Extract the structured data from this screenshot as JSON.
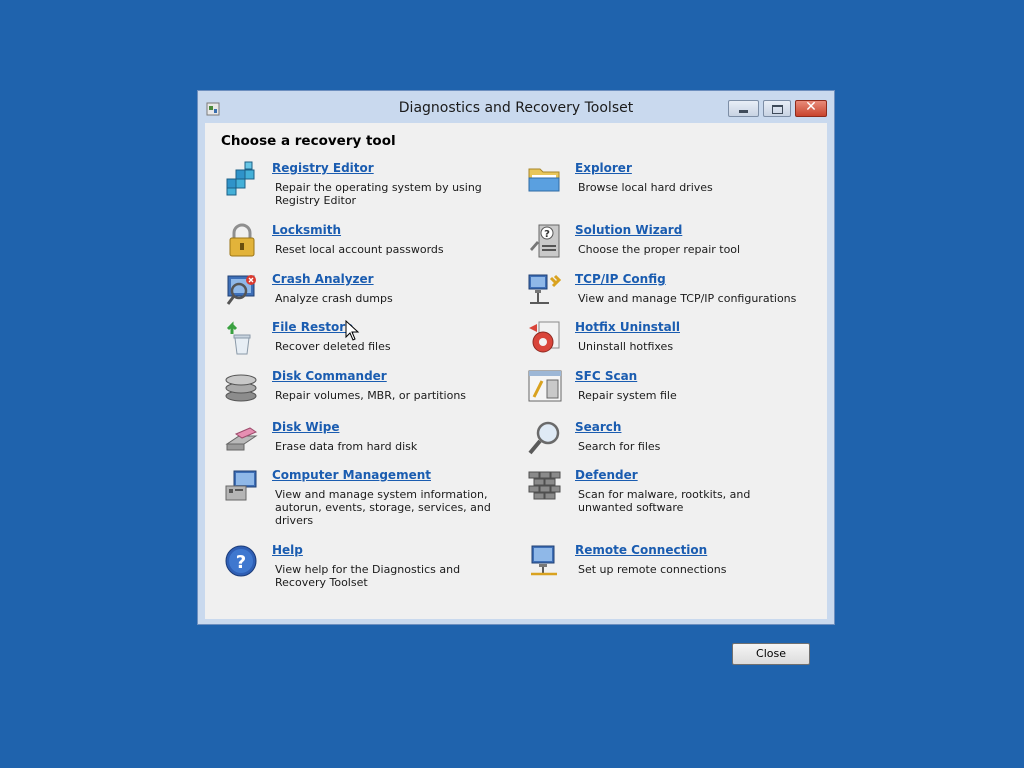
{
  "window": {
    "title": "Diagnostics and Recovery Toolset"
  },
  "heading": "Choose a recovery tool",
  "tools": {
    "left": [
      {
        "name": "Registry Editor",
        "desc": "Repair the operating system by using Registry Editor",
        "icon": "registry-editor-icon"
      },
      {
        "name": "Locksmith",
        "desc": "Reset local account passwords",
        "icon": "padlock-icon"
      },
      {
        "name": "Crash Analyzer",
        "desc": "Analyze crash dumps",
        "icon": "crash-analyzer-icon"
      },
      {
        "name": "File Restore",
        "desc": "Recover deleted files",
        "icon": "recycle-bin-restore-icon"
      },
      {
        "name": "Disk Commander",
        "desc": "Repair volumes, MBR, or partitions",
        "icon": "disk-stack-icon"
      },
      {
        "name": "Disk Wipe",
        "desc": "Erase data from hard disk",
        "icon": "eraser-icon"
      },
      {
        "name": "Computer Management",
        "desc": "View and manage system information, autorun, events, storage, services, and drivers",
        "icon": "computer-management-icon"
      },
      {
        "name": "Help",
        "desc": "View help for the Diagnostics and Recovery Toolset",
        "icon": "help-icon"
      }
    ],
    "right": [
      {
        "name": "Explorer",
        "desc": "Browse local hard drives",
        "icon": "folder-icon"
      },
      {
        "name": "Solution Wizard",
        "desc": "Choose the proper repair tool",
        "icon": "solution-wizard-icon"
      },
      {
        "name": "TCP/IP Config",
        "desc": "View and manage TCP/IP configurations",
        "icon": "network-config-icon"
      },
      {
        "name": "Hotfix Uninstall",
        "desc": "Uninstall hotfixes",
        "icon": "hotfix-uninstall-icon"
      },
      {
        "name": "SFC Scan",
        "desc": "Repair system file",
        "icon": "sfc-scan-icon"
      },
      {
        "name": "Search",
        "desc": "Search for files",
        "icon": "magnifier-icon"
      },
      {
        "name": "Defender",
        "desc": "Scan for malware, rootkits, and unwanted software",
        "icon": "brick-wall-icon"
      },
      {
        "name": "Remote Connection",
        "desc": "Set up remote connections",
        "icon": "remote-connection-icon"
      }
    ]
  },
  "buttons": {
    "close": "Close",
    "close_glyph": "✕"
  },
  "colors": {
    "desktop": "#1f63ad",
    "link": "#1a5cb0",
    "frame": "#c9d9ee"
  }
}
